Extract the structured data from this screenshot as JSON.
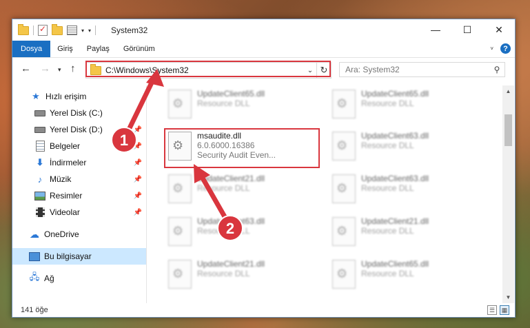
{
  "window": {
    "title": "System32",
    "controls": {
      "minimize": "—",
      "maximize": "☐",
      "close": "✕"
    }
  },
  "ribbon": {
    "tabs": [
      {
        "label": "Dosya",
        "active": true
      },
      {
        "label": "Giriş",
        "active": false
      },
      {
        "label": "Paylaş",
        "active": false
      },
      {
        "label": "Görünüm",
        "active": false
      }
    ],
    "help": "?"
  },
  "address": {
    "path": "C:\\Windows\\System32",
    "search_placeholder": "Ara: System32"
  },
  "sidebar": {
    "items": [
      {
        "label": "Hızlı erişim",
        "icon": "star-icon"
      },
      {
        "label": "Yerel Disk (C:)",
        "icon": "disk-icon"
      },
      {
        "label": "Yerel Disk (D:)",
        "icon": "disk-icon",
        "pinned": true
      },
      {
        "label": "Belgeler",
        "icon": "document-icon",
        "pinned": true
      },
      {
        "label": "İndirmeler",
        "icon": "download-icon",
        "pinned": true
      },
      {
        "label": "Müzik",
        "icon": "music-icon",
        "pinned": true
      },
      {
        "label": "Resimler",
        "icon": "picture-icon",
        "pinned": true
      },
      {
        "label": "Videolar",
        "icon": "video-icon",
        "pinned": true
      },
      {
        "label": "OneDrive",
        "icon": "cloud-icon"
      },
      {
        "label": "Bu bilgisayar",
        "icon": "computer-icon",
        "selected": true
      },
      {
        "label": "Ağ",
        "icon": "network-icon"
      }
    ]
  },
  "files": {
    "left": [
      {
        "name": "UpdateClient65.dll",
        "desc": "Resource DLL"
      },
      {
        "name": "msaudite.dll",
        "version": "6.0.6000.16386",
        "desc": "Security Audit Even..."
      },
      {
        "name": "UpdateClient21.dll",
        "desc": "Resource DLL"
      },
      {
        "name": "UpdateClient63.dll",
        "desc": "Resource DLL"
      },
      {
        "name": "UpdateClient21.dll",
        "desc": "Resource DLL"
      }
    ],
    "right": [
      {
        "name": "UpdateClient65.dll",
        "desc": "Resource DLL"
      },
      {
        "name": "UpdateClient63.dll",
        "desc": "Resource DLL"
      },
      {
        "name": "UpdateClient63.dll",
        "desc": "Resource DLL"
      },
      {
        "name": "UpdateClient21.dll",
        "desc": "Resource DLL"
      },
      {
        "name": "UpdateClient65.dll",
        "desc": "Resource DLL"
      }
    ]
  },
  "status": {
    "count": "141 öğe"
  },
  "annotations": {
    "step1": "1",
    "step2": "2",
    "color": "#d9363e"
  }
}
